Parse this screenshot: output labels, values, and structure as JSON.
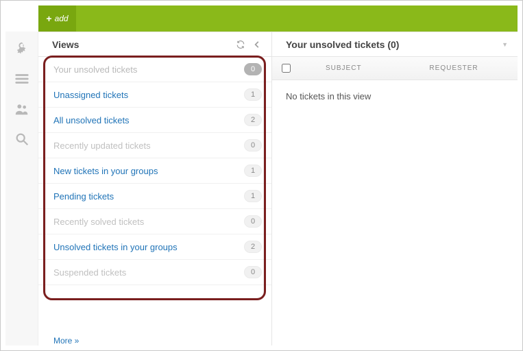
{
  "topbar": {
    "add_label": "add"
  },
  "views_panel": {
    "title": "Views",
    "more_label": "More »",
    "items": [
      {
        "label": "Your unsolved tickets",
        "count": "0",
        "state": "selected"
      },
      {
        "label": "Unassigned tickets",
        "count": "1",
        "state": "link"
      },
      {
        "label": "All unsolved tickets",
        "count": "2",
        "state": "link"
      },
      {
        "label": "Recently updated tickets",
        "count": "0",
        "state": "muted"
      },
      {
        "label": "New tickets in your groups",
        "count": "1",
        "state": "link"
      },
      {
        "label": "Pending tickets",
        "count": "1",
        "state": "link"
      },
      {
        "label": "Recently solved tickets",
        "count": "0",
        "state": "muted"
      },
      {
        "label": "Unsolved tickets in your groups",
        "count": "2",
        "state": "link"
      },
      {
        "label": "Suspended tickets",
        "count": "0",
        "state": "muted"
      }
    ]
  },
  "tickets_panel": {
    "title": "Your unsolved tickets (0)",
    "columns": {
      "subject": "SUBJECT",
      "requester": "REQUESTER"
    },
    "empty_message": "No tickets in this view"
  },
  "colors": {
    "accent": "#8ab91a",
    "link": "#1f73b7",
    "highlight": "#7a1e1e"
  }
}
